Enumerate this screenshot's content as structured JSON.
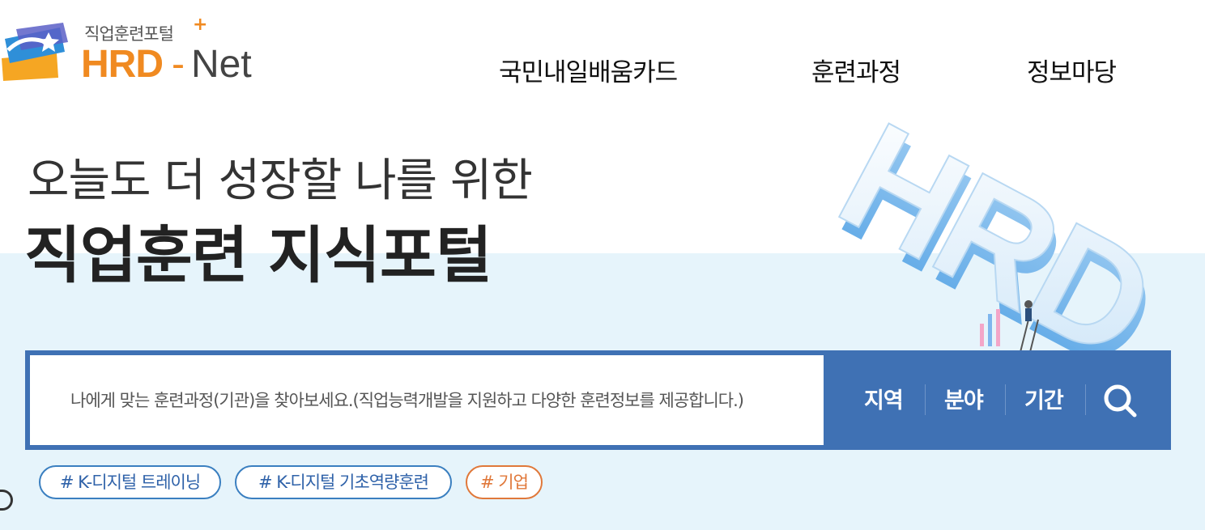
{
  "header": {
    "logo_subtitle": "직업훈련포털",
    "logo_plus": "+",
    "logo_hrd": "HRD",
    "logo_dash": "-",
    "logo_net": "Net",
    "nav": [
      "국민내일배움카드",
      "훈련과정",
      "정보마당"
    ]
  },
  "hero": {
    "subtitle": "오늘도 더 성장할 나를 위한",
    "title": "직업훈련 지식포털",
    "illustration_text": "HRD"
  },
  "search": {
    "placeholder": "나에게 맞는 훈련과정(기관)을 찾아보세요.(직업능력개발을 지원하고 다양한 훈련정보를 제공합니다.)",
    "filters": [
      "지역",
      "분야",
      "기간"
    ],
    "button_icon": "search-icon"
  },
  "tags": [
    {
      "label": "# K-디지털 트레이닝",
      "color": "#3a7fc0"
    },
    {
      "label": "# K-디지털 기초역량훈련",
      "color": "#3a7fc0"
    },
    {
      "label": "# 기업",
      "color": "#e0783a"
    }
  ],
  "colors": {
    "brand_orange": "#f08a21",
    "search_blue": "#3f71b4",
    "band_bg": "#e6f4fb"
  }
}
